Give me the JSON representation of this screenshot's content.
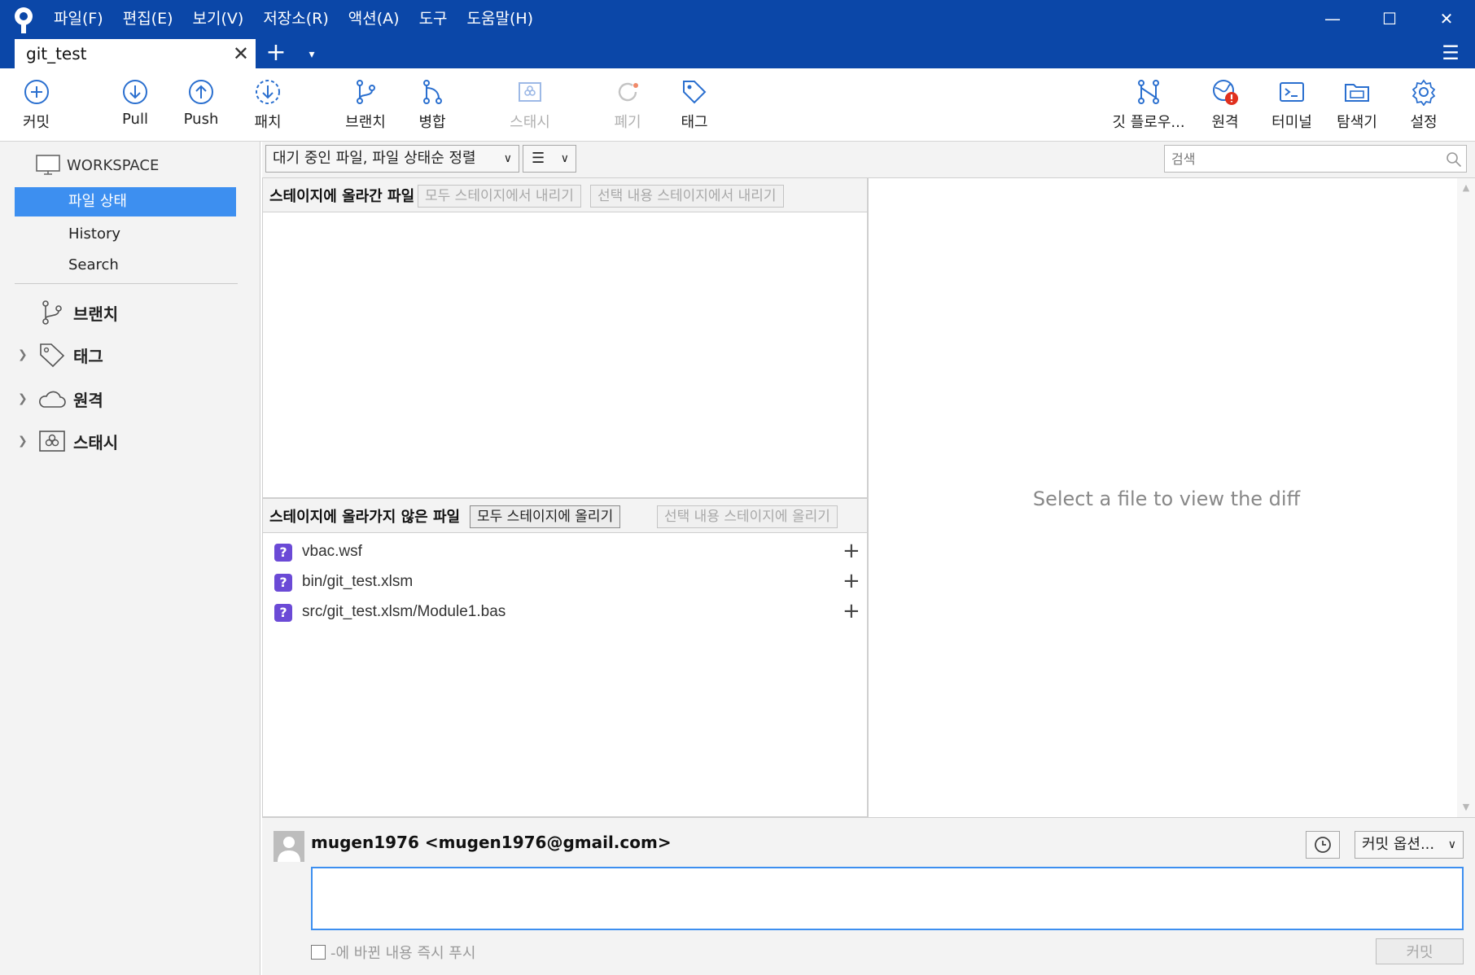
{
  "menu": [
    "파일(F)",
    "편집(E)",
    "보기(V)",
    "저장소(R)",
    "액션(A)",
    "도구",
    "도움말(H)"
  ],
  "window": {
    "min": "—",
    "max": "☐",
    "close": "✕"
  },
  "tab": {
    "title": "git_test",
    "close": "✕",
    "add": "+",
    "dropdown": "▾"
  },
  "hamburger": "☰",
  "toolbar": {
    "commit": "커밋",
    "pull": "Pull",
    "push": "Push",
    "fetch": "패치",
    "branch": "브랜치",
    "merge": "병합",
    "stash": "스태시",
    "discard": "폐기",
    "tag": "태그",
    "gitflow": "깃 플로우...",
    "remote": "원격",
    "terminal": "터미널",
    "explorer": "탐색기",
    "settings": "설정"
  },
  "sidebar": {
    "workspace": "WORKSPACE",
    "items": [
      "파일 상태",
      "History",
      "Search"
    ],
    "groups": [
      "브랜치",
      "태그",
      "원격",
      "스태시"
    ]
  },
  "filter": {
    "sort": "대기 중인 파일, 파일 상태순 정렬",
    "view": "☰",
    "search_placeholder": "검색"
  },
  "staged": {
    "title": "스테이지에 올라간 파일",
    "unstage_all": "모두 스테이지에서 내리기",
    "unstage_selected": "선택 내용 스테이지에서 내리기"
  },
  "unstaged": {
    "title": "스테이지에 올라가지 않은 파일",
    "stage_all": "모두 스테이지에 올리기",
    "stage_selected": "선택 내용 스테이지에 올리기",
    "files": [
      {
        "status": "?",
        "name": "vbac.wsf"
      },
      {
        "status": "?",
        "name": "bin/git_test.xlsm"
      },
      {
        "status": "?",
        "name": "src/git_test.xlsm/Module1.bas"
      }
    ]
  },
  "diff": {
    "placeholder": "Select a file to view the diff"
  },
  "commit": {
    "author": "mugen1976 <mugen1976@gmail.com>",
    "options": "커밋 옵션...",
    "push_label": "-에 바뀐 내용 즉시 푸시",
    "button": "커밋"
  },
  "colors": {
    "titlebar": "#0b47a8",
    "accent": "#3d8ff0",
    "untracked": "#6b4ad6",
    "alert": "#e0301e"
  }
}
